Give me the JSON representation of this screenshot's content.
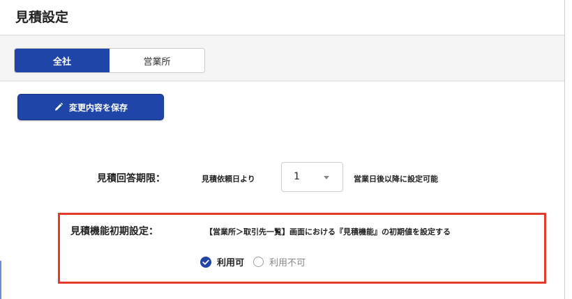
{
  "page": {
    "title": "見積設定"
  },
  "tabs": [
    {
      "label": "全社",
      "active": true
    },
    {
      "label": "営業所",
      "active": false
    }
  ],
  "toolbar": {
    "save_label": "変更内容を保存",
    "save_icon": "pencil-icon"
  },
  "deadline": {
    "label": "見積回答期限：",
    "prefix": "見積依頼日より",
    "select_value": "1",
    "suffix": "営業日後以降に設定可能"
  },
  "estimate_feature": {
    "label": "見積機能初期設定：",
    "description": "【営業所＞取引先一覧】画面における『見積機能』の初期値を設定する",
    "options": [
      {
        "label": "利用可",
        "checked": true
      },
      {
        "label": "利用不可",
        "checked": false
      }
    ]
  },
  "colors": {
    "accent": "#1f45a8",
    "highlight_border": "#e33a2b"
  }
}
